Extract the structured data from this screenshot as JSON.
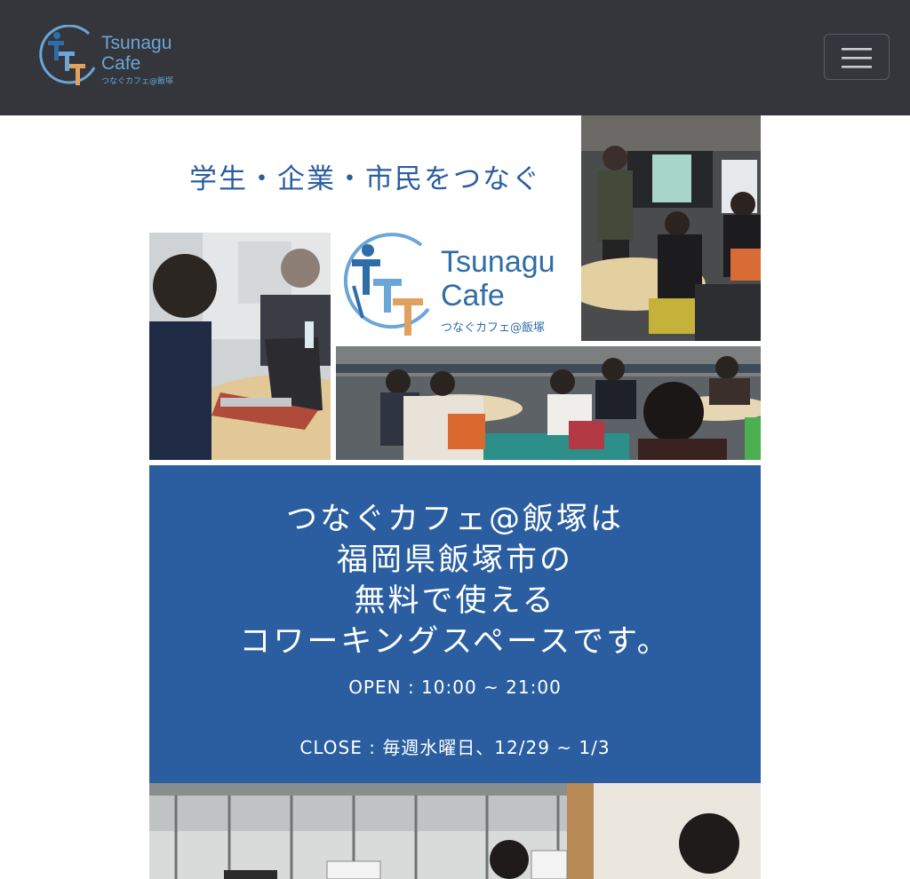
{
  "navbar": {
    "logo": {
      "line1": "Tsunagu",
      "line2": "Cafe",
      "line3": "つなぐカフェ@飯塚"
    },
    "menu_icon": "hamburger-menu-icon",
    "background_color": "#34363b"
  },
  "banner": {
    "headline": "学生・企業・市民をつなぐ",
    "logo": {
      "line1": "Tsunagu",
      "line2": "Cafe",
      "line3": "つなぐカフェ@飯塚"
    }
  },
  "info": {
    "title_lines": [
      "つなぐカフェ@飯塚は",
      "福岡県飯塚市の",
      "無料で使える",
      "コワーキングスペースです。"
    ],
    "open": "OPEN : 10:00 ~ 21:00",
    "close": "CLOSE : 毎週水曜日、12/29 ~ 1/3",
    "background_color": "#2a5ea0"
  },
  "colors": {
    "brand_blue": "#2a5ea0",
    "logo_blue": "#6aa6d8",
    "logo_orange": "#e0a060"
  }
}
